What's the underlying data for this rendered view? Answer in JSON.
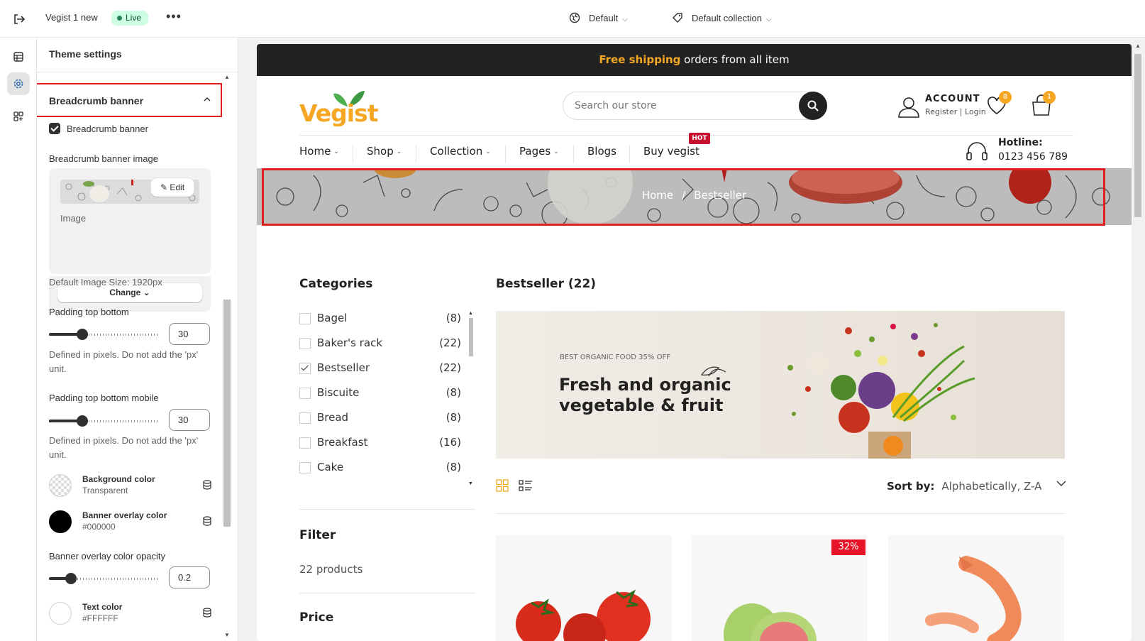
{
  "topbar": {
    "theme_name": "Vegist 1 new",
    "status": "Live",
    "more": "•••",
    "template_select": "Default",
    "collection_select": "Default collection"
  },
  "panel": {
    "title": "Theme settings",
    "section_title": "Breadcrumb banner",
    "checkbox_label": "Breadcrumb banner",
    "image_label": "Breadcrumb banner image",
    "edit_label": "Edit",
    "image_caption": "Image",
    "change_label": "Change",
    "image_size_help": "Default Image Size: 1920px",
    "padding_label": "Padding top bottom",
    "padding_value": "30",
    "padding_fraction": 0.3,
    "padding_help": "Defined in pixels. Do not add the 'px' unit.",
    "padding_mobile_label": "Padding top bottom mobile",
    "padding_mobile_value": "30",
    "padding_mobile_fraction": 0.3,
    "padding_mobile_help": "Defined in pixels. Do not add the 'px' unit.",
    "bg_color_label": "Background color",
    "bg_color_value": "Transparent",
    "overlay_color_label": "Banner overlay color",
    "overlay_color_value": "#000000",
    "overlay_opacity_label": "Banner overlay color opacity",
    "overlay_opacity_value": "0.2",
    "overlay_opacity_fraction": 0.2,
    "text_color_label": "Text color",
    "text_color_value": "#FFFFFF"
  },
  "store": {
    "promo_highlight": "Free shipping",
    "promo_rest": " orders from all item",
    "logo": "Vegist",
    "search_placeholder": "Search our store",
    "account_title": "ACCOUNT",
    "account_register": "Register",
    "account_login": "Login",
    "wishlist_count": "8",
    "cart_count": "1",
    "nav": [
      "Home",
      "Shop",
      "Collection",
      "Pages",
      "Blogs",
      "Buy vegist"
    ],
    "hot_badge": "HOT",
    "hotline_title": "Hotline:",
    "hotline_number": "0123 456 789",
    "breadcrumb_home": "Home",
    "breadcrumb_sep": "/",
    "breadcrumb_current": "Bestseller",
    "categories_title": "Categories",
    "categories": [
      {
        "name": "Bagel",
        "count": "(8)",
        "checked": false
      },
      {
        "name": "Baker's rack",
        "count": "(22)",
        "checked": false
      },
      {
        "name": "Bestseller",
        "count": "(22)",
        "checked": true
      },
      {
        "name": "Biscuite",
        "count": "(8)",
        "checked": false
      },
      {
        "name": "Bread",
        "count": "(8)",
        "checked": false
      },
      {
        "name": "Breakfast",
        "count": "(16)",
        "checked": false
      },
      {
        "name": "Cake",
        "count": "(8)",
        "checked": false
      }
    ],
    "filter_title": "Filter",
    "filter_count": "22 products",
    "price_title": "Price",
    "collection_title": "Bestseller (22)",
    "hero_small": "BEST ORGANIC FOOD 35% OFF",
    "hero_line1": "Fresh and organic",
    "hero_line2": "vegetable & fruit",
    "sort_label": "Sort by:",
    "sort_value": "Alphabetically, Z-A",
    "sale_badge": "32%"
  },
  "colors": {
    "accent": "#f5a623",
    "highlight_outline": "#e02020",
    "live_bg": "#cdfee1",
    "sale": "#e8152a"
  }
}
